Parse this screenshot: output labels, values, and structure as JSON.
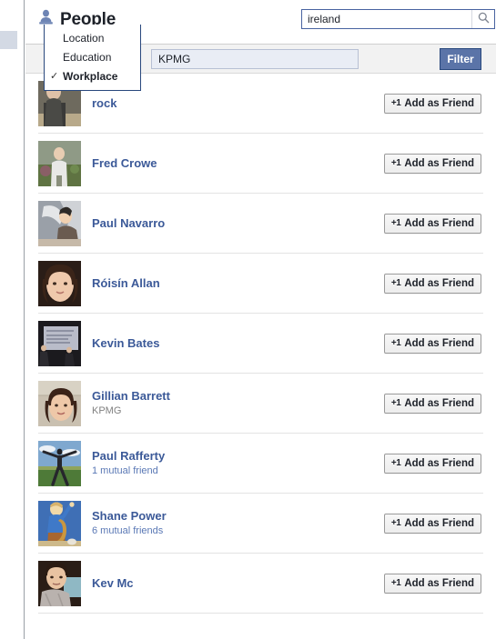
{
  "header": {
    "title": "People",
    "title_icon": "person-icon",
    "search": {
      "value": "ireland",
      "placeholder": "Search",
      "icon": "search-icon"
    }
  },
  "filter_bar": {
    "dropdown": {
      "label": "Workplace",
      "icon": "search-icon",
      "caret_icon": "chevron-down-icon"
    },
    "value_input": {
      "value": "KPMG",
      "placeholder": "Workplace"
    },
    "submit_label": "Filter",
    "menu": {
      "items": [
        {
          "label": "Location",
          "selected": false
        },
        {
          "label": "Education",
          "selected": false
        },
        {
          "label": "Workplace",
          "selected": true
        }
      ],
      "check_glyph": "✓"
    }
  },
  "people": {
    "add_friend_label": "Add as Friend",
    "add_friend_icon": "+1",
    "rows": [
      {
        "name": "rock",
        "sub": "",
        "sub_kind": "",
        "avatar": "photo-man-dark"
      },
      {
        "name": "Fred Crowe",
        "sub": "",
        "sub_kind": "",
        "avatar": "photo-man-garden"
      },
      {
        "name": "Paul Navarro",
        "sub": "",
        "sub_kind": "",
        "avatar": "photo-man-car"
      },
      {
        "name": "Róisín Allan",
        "sub": "",
        "sub_kind": "",
        "avatar": "photo-woman-portrait"
      },
      {
        "name": "Kevin Bates",
        "sub": "",
        "sub_kind": "",
        "avatar": "photo-presentation"
      },
      {
        "name": "Gillian Barrett",
        "sub": "KPMG",
        "sub_kind": "gray",
        "avatar": "photo-woman-wall"
      },
      {
        "name": "Paul Rafferty",
        "sub": "1 mutual friend",
        "sub_kind": "blue",
        "avatar": "photo-man-hilltop"
      },
      {
        "name": "Shane Power",
        "sub": "6 mutual friends",
        "sub_kind": "blue",
        "avatar": "illustration-man-guitar"
      },
      {
        "name": "Kev Mc",
        "sub": "",
        "sub_kind": "",
        "avatar": "photo-man-night"
      }
    ]
  },
  "colors": {
    "brand_blue": "#3b5998",
    "link_blue": "#3b5998",
    "mutual_blue": "#5a78b5",
    "sub_gray": "#808080",
    "filter_bar_bg": "#f2f2f2",
    "field_bg": "#e9edf5"
  }
}
